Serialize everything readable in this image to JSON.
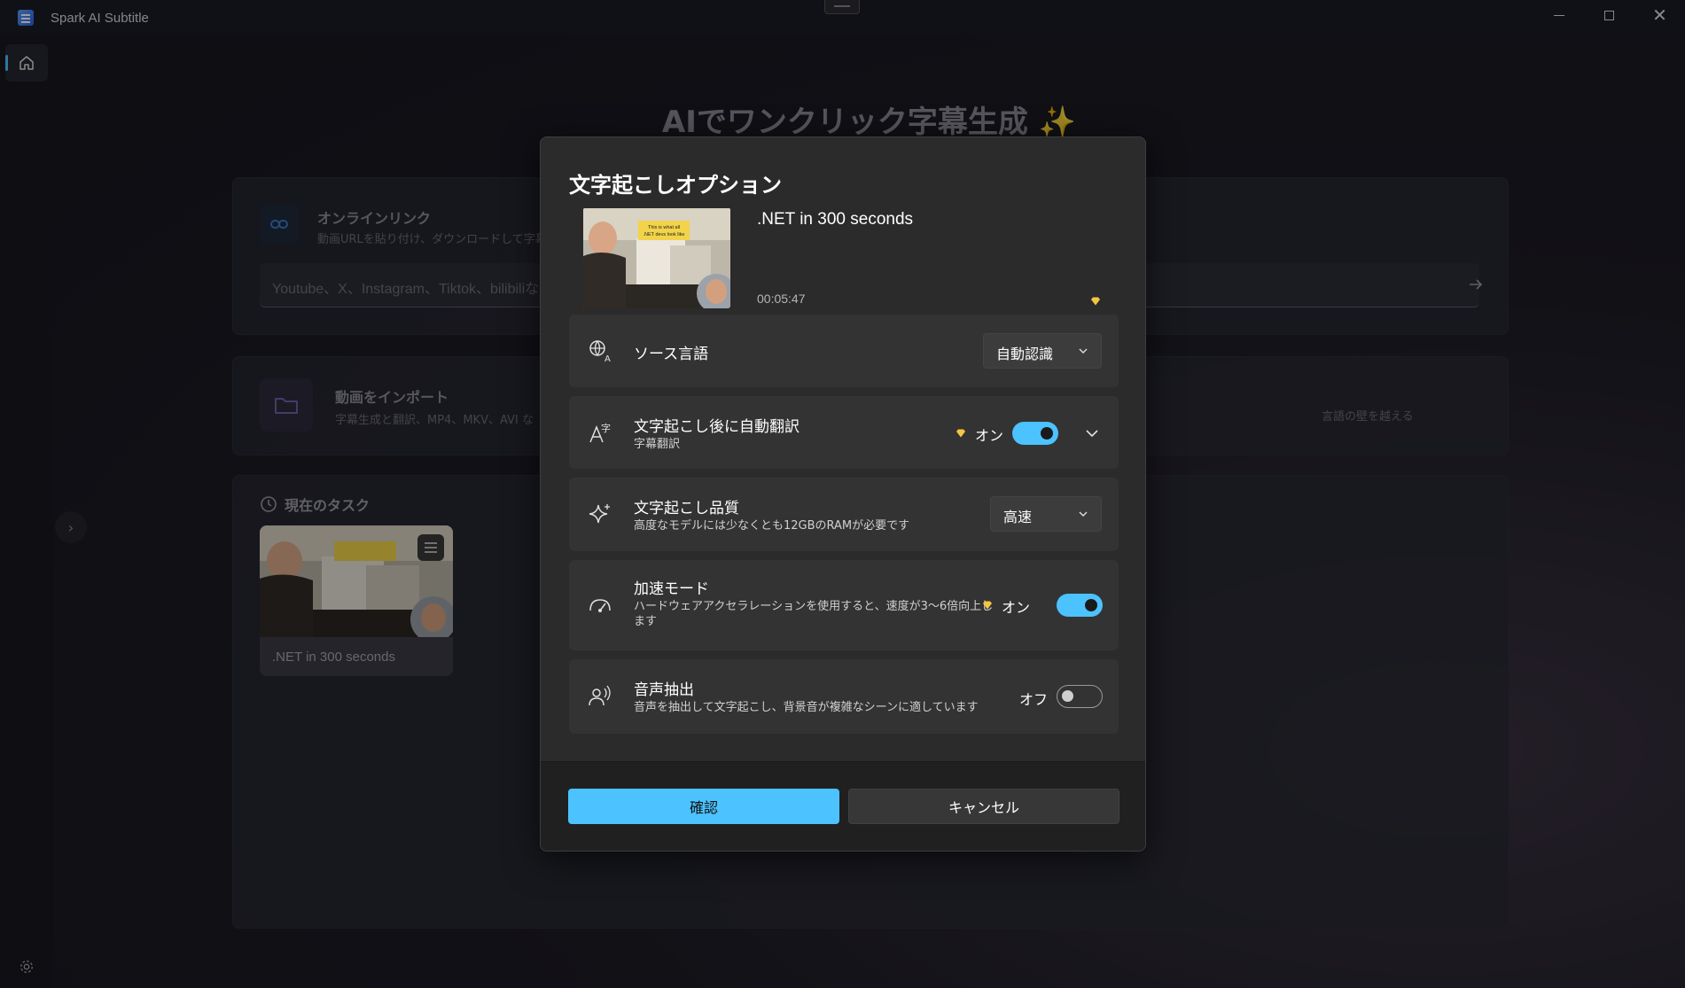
{
  "window": {
    "title": "Spark AI Subtitle"
  },
  "hero": {
    "title": "AIでワンクリック字幕生成 ✨"
  },
  "online_link": {
    "title": "オンラインリンク",
    "subtitle": "動画URLを貼り付け、ダウンロードして字幕と",
    "input_placeholder": "Youtube、X、Instagram、Tiktok、bilibiliな"
  },
  "import": {
    "title": "動画をインポート",
    "subtitle": "字幕生成と翻訳、MP4、MKV、AVI な",
    "subtitle_right": "言語の壁を越える"
  },
  "tasks": {
    "title": "現在のタスク",
    "items": [
      {
        "name": ".NET in 300 seconds"
      }
    ]
  },
  "dialog": {
    "title": "文字起こしオプション",
    "video": {
      "title": ".NET in 300 seconds",
      "duration": "00:05:47",
      "thumb_caption": "This is what all .NET devs look like"
    },
    "source_language": {
      "label": "ソース言語",
      "value": "自動認識"
    },
    "auto_translate": {
      "label": "文字起こし後に自動翻訳",
      "sublabel": "字幕翻訳",
      "state_label": "オン",
      "enabled": true
    },
    "quality": {
      "label": "文字起こし品質",
      "sublabel": "高度なモデルには少なくとも12GBのRAMが必要です",
      "value": "高速"
    },
    "acceleration": {
      "label": "加速モード",
      "sublabel_line1": "ハードウェアアクセラレーションを使用すると、速度が3～6倍向上し",
      "sublabel_line2": "ます",
      "state_label": "オン",
      "enabled": true
    },
    "voice_extract": {
      "label": "音声抽出",
      "sublabel": "音声を抽出して文字起こし、背景音が複雑なシーンに適しています",
      "state_label": "オフ",
      "enabled": false
    },
    "confirm_label": "確認",
    "cancel_label": "キャンセル"
  },
  "colors": {
    "accent": "#4cc2ff",
    "premium": "#f5c542",
    "dialog_bg": "#2b2b2b",
    "row_bg": "#333333"
  },
  "icons": [
    "home-icon",
    "settings-icon",
    "link-icon",
    "folder-icon",
    "clock-icon",
    "menu-icon",
    "arrow-right-icon",
    "chevron-right-icon",
    "language-icon",
    "translate-icon",
    "sparkle-icon",
    "speedometer-icon",
    "voice-icon",
    "chevron-down-icon",
    "premium-gem-icon"
  ]
}
